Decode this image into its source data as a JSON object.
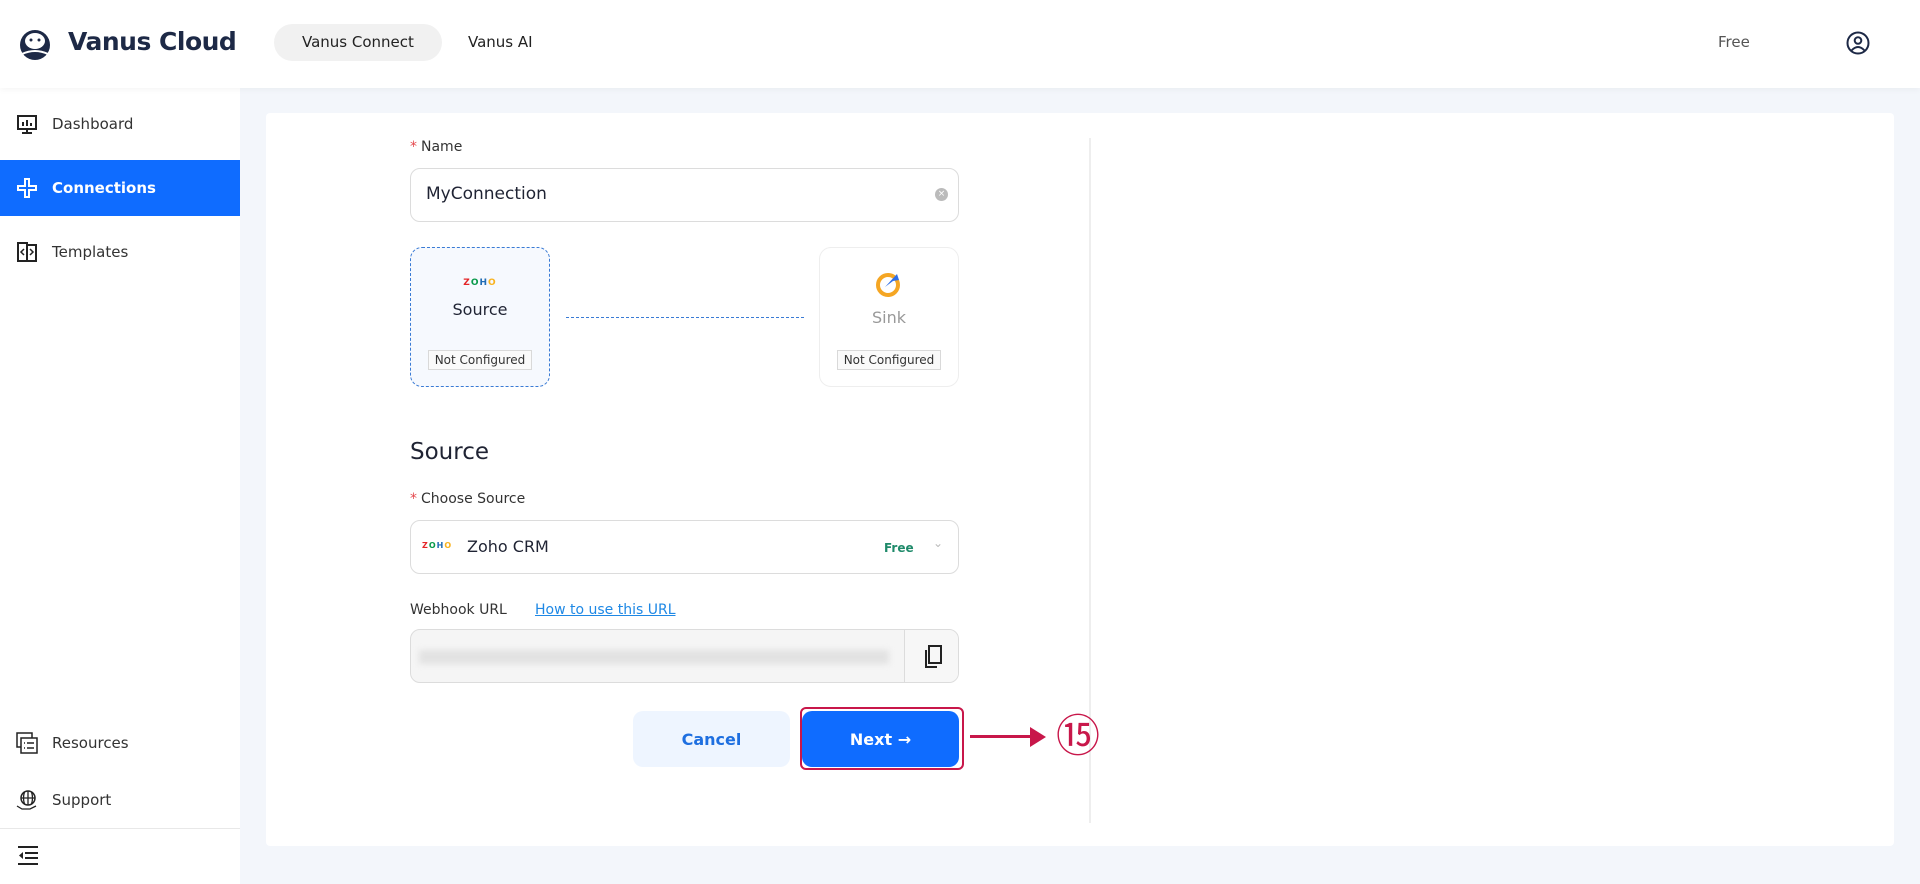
{
  "header": {
    "brand": "Vanus Cloud",
    "tabs": [
      {
        "label": "Vanus Connect",
        "active": true
      },
      {
        "label": "Vanus AI",
        "active": false
      }
    ],
    "plan": "Free"
  },
  "sidebar": {
    "items": [
      {
        "label": "Dashboard",
        "icon": "dashboard-icon"
      },
      {
        "label": "Connections",
        "icon": "connections-icon",
        "active": true
      },
      {
        "label": "Templates",
        "icon": "templates-icon"
      }
    ],
    "bottom": [
      {
        "label": "Resources",
        "icon": "resources-icon"
      },
      {
        "label": "Support",
        "icon": "support-icon"
      }
    ]
  },
  "form": {
    "name_label": "Name",
    "name_value": "MyConnection",
    "source_node": {
      "label": "Source",
      "status": "Not Configured"
    },
    "sink_node": {
      "label": "Sink",
      "status": "Not Configured"
    },
    "section_title": "Source",
    "choose_label": "Choose Source",
    "choose_value": "Zoho CRM",
    "choose_badge": "Free",
    "webhook_label": "Webhook URL",
    "webhook_help": "How to use this URL",
    "cancel": "Cancel",
    "next": "Next →"
  },
  "annotation": {
    "step": "⑮"
  },
  "colors": {
    "primary": "#0f6cff",
    "annotation": "#c8174a",
    "free": "#1f8a6a"
  }
}
